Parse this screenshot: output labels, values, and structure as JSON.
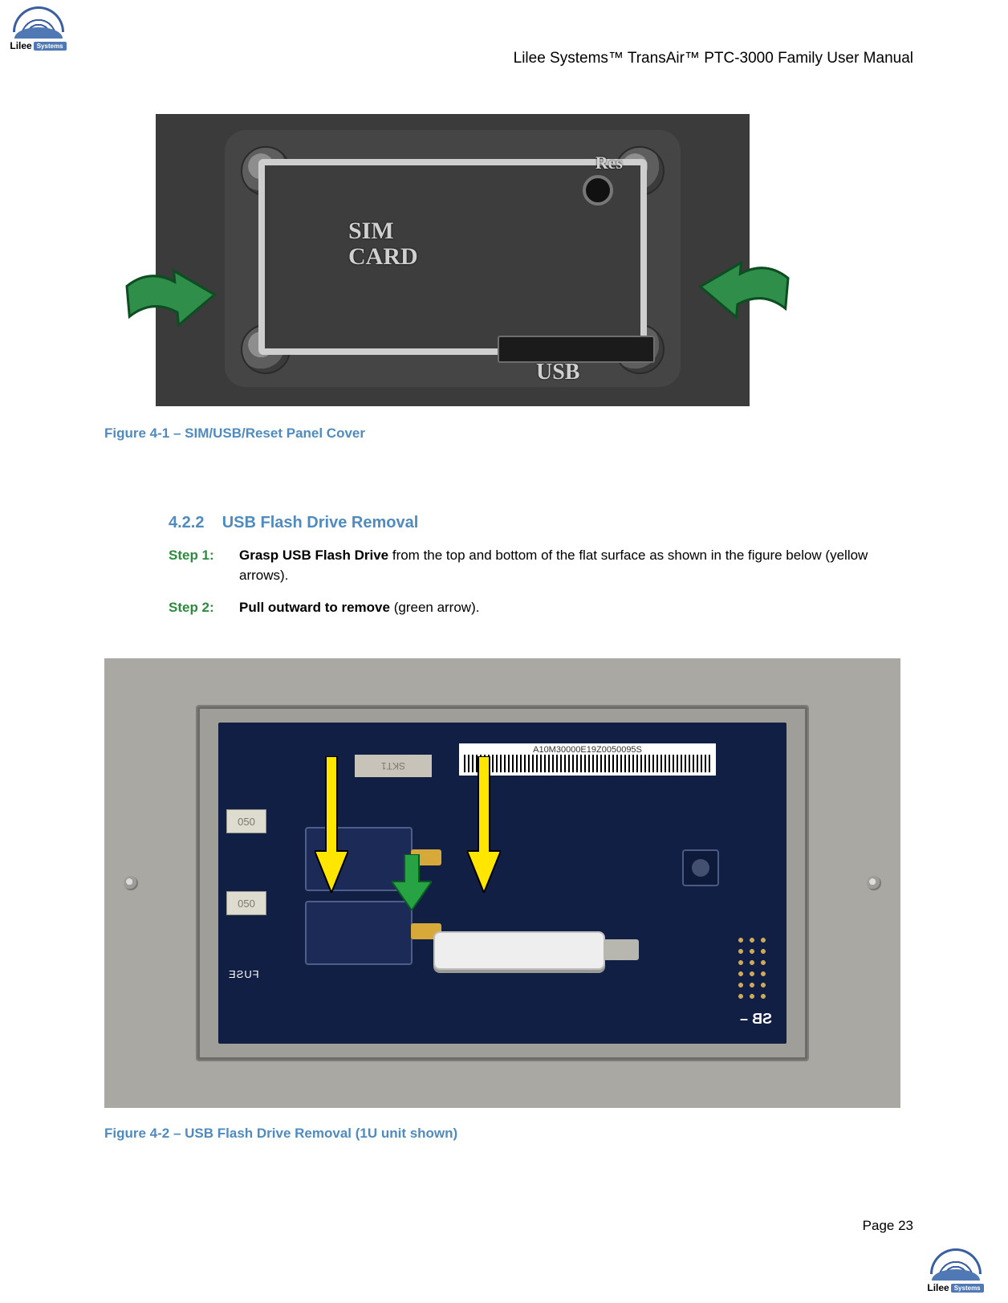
{
  "header": {
    "brand_text": "Lilee",
    "brand_chip": "Systems",
    "title": "Lilee Systems™ TransAir™ PTC-3000 Family User Manual"
  },
  "figure1": {
    "caption": "Figure 4-1 – SIM/USB/Reset Panel Cover",
    "label_sim_line1": "SIM",
    "label_sim_line2": "CARD",
    "label_usb": "USB",
    "label_reset": "Res"
  },
  "section": {
    "number": "4.2.2",
    "title": "USB Flash Drive Removal"
  },
  "steps": [
    {
      "label": "Step 1:",
      "bold": "Grasp USB Flash Drive",
      "rest": " from the top and bottom of the flat surface as shown in the figure below (yellow arrows)."
    },
    {
      "label": "Step 2:",
      "bold": "Pull outward to remove",
      "rest": " (green arrow)."
    }
  ],
  "figure2": {
    "caption": "Figure 4-2 – USB Flash Drive Removal (1U unit shown)",
    "barcode_text": "A10M30000E19Z0050095S",
    "label_050": "050",
    "label_fuse": "FUSE",
    "label_skt": "SKT1",
    "label_sb": "SB –"
  },
  "footer": {
    "page": "Page 23"
  }
}
